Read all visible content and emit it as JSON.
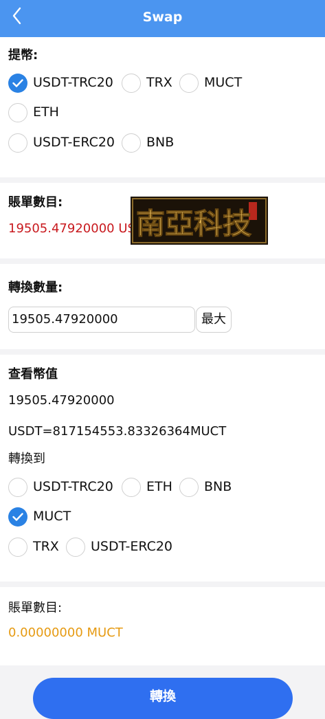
{
  "header": {
    "title": "Swap"
  },
  "withdraw": {
    "label": "提幣:",
    "options": [
      {
        "label": "USDT-TRC20",
        "checked": true
      },
      {
        "label": "TRX",
        "checked": false
      },
      {
        "label": "MUCT",
        "checked": false
      },
      {
        "label": "ETH",
        "checked": false
      },
      {
        "label": "USDT-ERC20",
        "checked": false
      },
      {
        "label": "BNB",
        "checked": false
      }
    ]
  },
  "account": {
    "label": "賬單數目:",
    "value": "19505.47920000 USDT",
    "watermark_text": "南亞科技"
  },
  "amount": {
    "label": "轉換數量:",
    "input_value": "19505.47920000",
    "max_label": "最大"
  },
  "rate": {
    "label": "查看幣值",
    "value1": "19505.47920000",
    "value2": "USDT=817154553.83326364MUCT"
  },
  "convert_to": {
    "label": "轉換到",
    "options": [
      {
        "label": "USDT-TRC20",
        "checked": false
      },
      {
        "label": "ETH",
        "checked": false
      },
      {
        "label": "BNB",
        "checked": false
      },
      {
        "label": "MUCT",
        "checked": true
      },
      {
        "label": "TRX",
        "checked": false
      },
      {
        "label": "USDT-ERC20",
        "checked": false
      }
    ]
  },
  "result": {
    "label": "賬單數目:",
    "value": "0.00000000 MUCT"
  },
  "submit": {
    "label": "轉換"
  },
  "colors": {
    "header": "#4b95f0",
    "accent": "#2a82e4",
    "red_value": "#c8191e",
    "orange_value": "#e69a12",
    "button": "#2f6ff0"
  }
}
